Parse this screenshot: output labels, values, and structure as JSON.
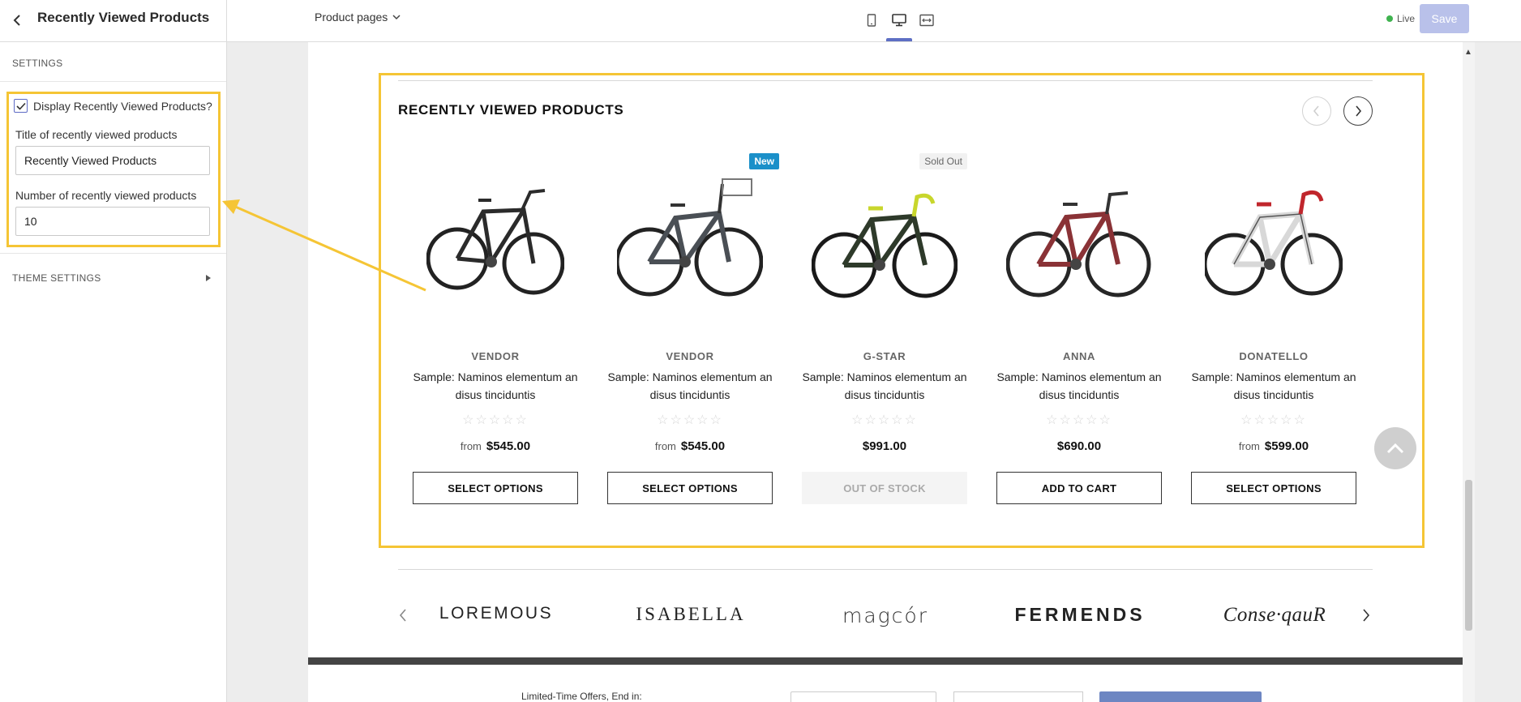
{
  "editor": {
    "title": "Recently Viewed Products",
    "page_selector": "Product pages",
    "status": "Live",
    "save_label": "Save",
    "accent_color": "#5e6fc4"
  },
  "sidebar": {
    "settings_heading": "SETTINGS",
    "display_checkbox_label": "Display Recently Viewed Products?",
    "display_checked": true,
    "title_field_label": "Title of recently viewed products",
    "title_field_value": "Recently Viewed Products",
    "count_field_label": "Number of recently viewed products",
    "count_field_value": "10",
    "theme_settings_label": "THEME SETTINGS"
  },
  "preview": {
    "section_title": "RECENTLY VIEWED PRODUCTS",
    "highlight_color": "#f5c535",
    "products": [
      {
        "vendor": "VENDOR",
        "name": "Sample: Naminos elementum an disus tinciduntis",
        "from": "from",
        "price": "$545.00",
        "button": "SELECT OPTIONS",
        "badge": "",
        "rating": "☆☆☆☆☆"
      },
      {
        "vendor": "VENDOR",
        "name": "Sample: Naminos elementum an disus tinciduntis",
        "from": "from",
        "price": "$545.00",
        "button": "SELECT OPTIONS",
        "badge": "New",
        "rating": "☆☆☆☆☆"
      },
      {
        "vendor": "G-STAR",
        "name": "Sample: Naminos elementum an disus tinciduntis",
        "from": "",
        "price": "$991.00",
        "button": "OUT OF STOCK",
        "badge": "Sold Out",
        "rating": "☆☆☆☆☆"
      },
      {
        "vendor": "ANNA",
        "name": "Sample: Naminos elementum an disus tinciduntis",
        "from": "",
        "price": "$690.00",
        "button": "ADD TO CART",
        "badge": "",
        "rating": "☆☆☆☆☆"
      },
      {
        "vendor": "DONATELLO",
        "name": "Sample: Naminos elementum an disus tinciduntis",
        "from": "from",
        "price": "$599.00",
        "button": "SELECT OPTIONS",
        "badge": "",
        "rating": "☆☆☆☆☆"
      }
    ],
    "brands": [
      "LOREMOUS",
      "ISABELLA",
      "magcór",
      "FERMENDS",
      "Conse·qauR"
    ],
    "footer_promo_text": "Limited-Time Offers, End in:"
  }
}
